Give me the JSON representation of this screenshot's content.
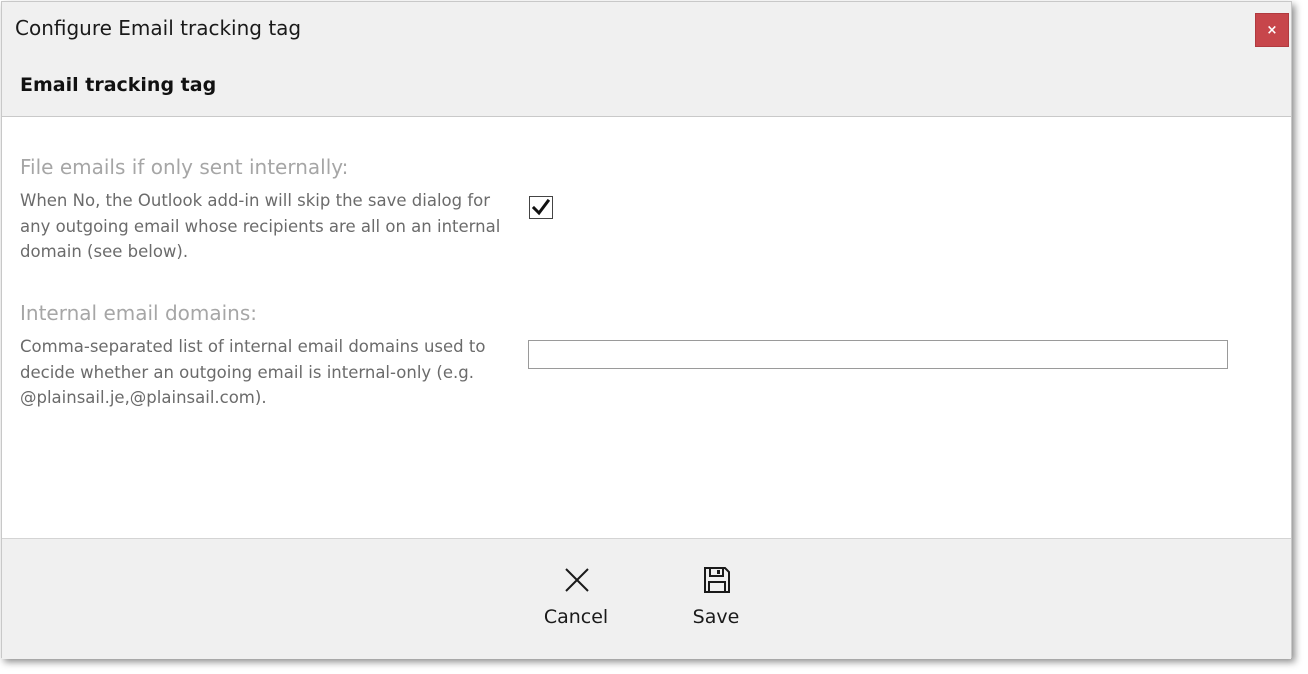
{
  "dialog": {
    "title": "Configure Email tracking tag",
    "close_label": "×"
  },
  "section": {
    "title": "Email tracking tag"
  },
  "fields": {
    "file_internal": {
      "label": "File emails if only sent internally:",
      "description": "When No, the Outlook add-in will skip the save dialog for any outgoing email whose recipients are all on an internal domain (see below).",
      "checked": true
    },
    "internal_domains": {
      "label": "Internal email domains:",
      "description": "Comma-separated list of internal email domains used to decide whether an outgoing email is internal-only (e.g. @plainsail.je,@plainsail.com).",
      "value": "",
      "placeholder": ""
    }
  },
  "footer": {
    "cancel_label": "Cancel",
    "cancel_icon": "close-x-icon",
    "save_label": "Save",
    "save_icon": "floppy-disk-icon"
  },
  "colors": {
    "close_button_bg": "#c7464b",
    "panel_bg": "#f0f0f0",
    "label_gray": "#a6a6a6",
    "desc_gray": "#6b6b6b"
  }
}
